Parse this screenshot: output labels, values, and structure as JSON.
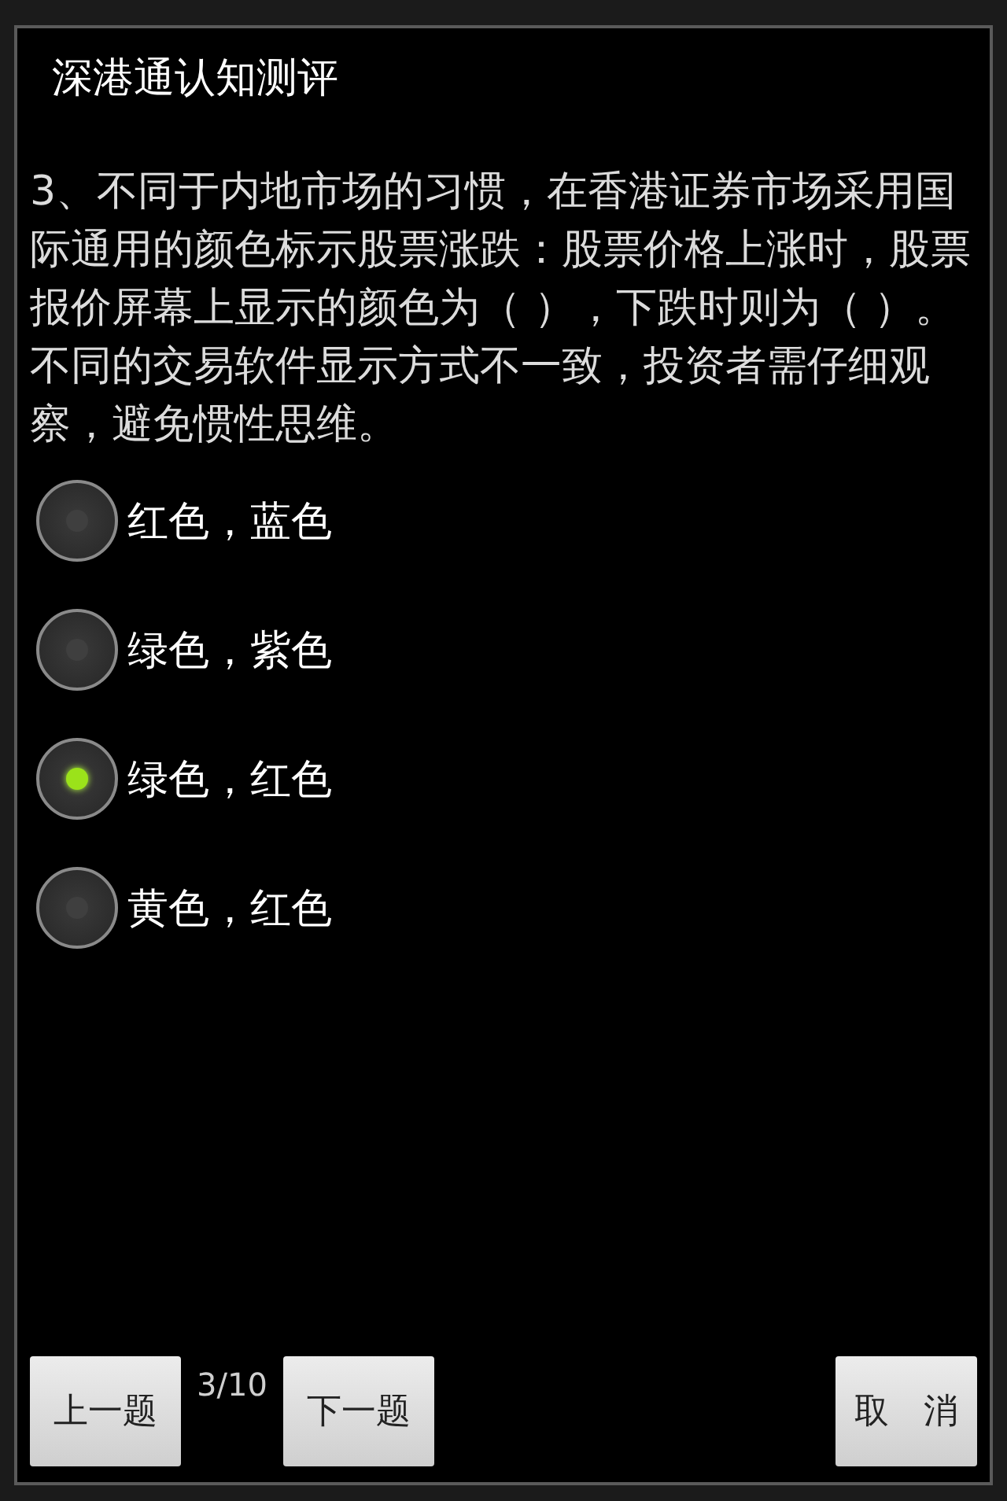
{
  "dialog": {
    "title": "深港通认知测评",
    "question": "3、不同于内地市场的习惯，在香港证券市场采用国际通用的颜色标示股票涨跌：股票价格上涨时，股票报价屏幕上显示的颜色为（  ），下跌时则为（  ）。不同的交易软件显示方式不一致，投资者需仔细观察，避免惯性思维。",
    "options": [
      {
        "label": "红色，蓝色",
        "selected": false
      },
      {
        "label": "绿色，紫色",
        "selected": false
      },
      {
        "label": "绿色，红色",
        "selected": true
      },
      {
        "label": "黄色，红色",
        "selected": false
      }
    ],
    "prev_button": "上一题",
    "progress": "3/10",
    "next_button": "下一题",
    "cancel_button": "取　消"
  }
}
